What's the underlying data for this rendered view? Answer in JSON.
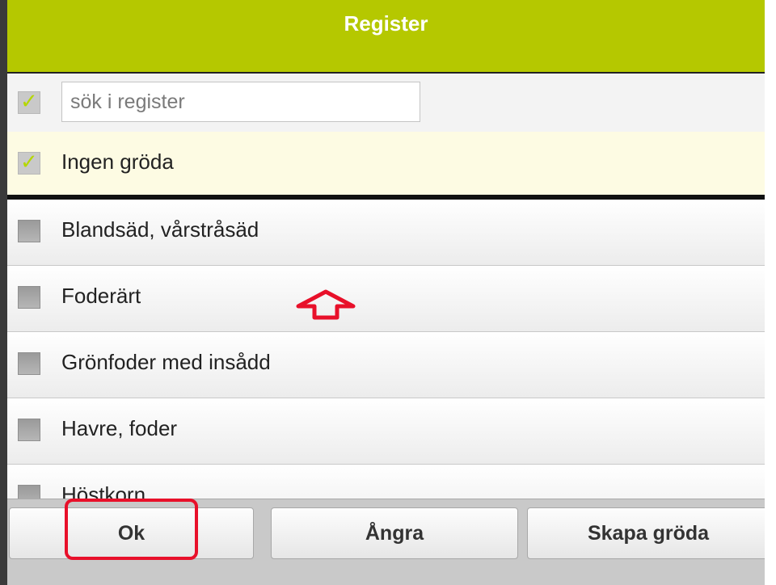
{
  "header": {
    "title": "Register"
  },
  "search": {
    "placeholder": "sök i register",
    "value": "",
    "select_all_checked": true
  },
  "selected": {
    "label": "Ingen gröda",
    "checked": true
  },
  "list": {
    "items": [
      {
        "label": "Blandsäd, vårstråsäd",
        "checked": false
      },
      {
        "label": "Foderärt",
        "checked": false
      },
      {
        "label": "Grönfoder med insådd",
        "checked": false
      },
      {
        "label": "Havre, foder",
        "checked": false
      },
      {
        "label": "Höstkorn",
        "checked": false
      }
    ]
  },
  "buttons": {
    "ok": "Ok",
    "undo": "Ångra",
    "create": "Skapa gröda"
  },
  "colors": {
    "header": "#b5c800",
    "check": "#b5d700",
    "annotation": "#e8102a",
    "selected_row": "#fdfbe3"
  },
  "icons": {
    "checkbox_checked": "checkmark-icon",
    "annotation_arrow": "up-arrow-icon"
  }
}
